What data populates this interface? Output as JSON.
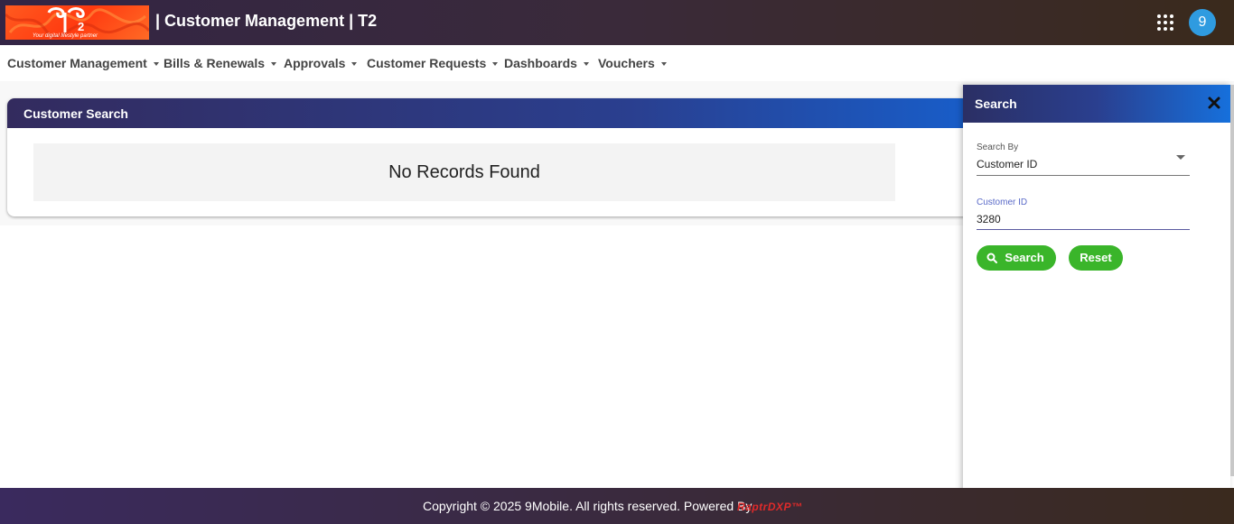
{
  "header": {
    "logo_text": "T2",
    "logo_tagline": "Your digital lifestyle partner",
    "title": "| Customer Management | T2",
    "avatar_initial": "9"
  },
  "nav": {
    "items": [
      {
        "label": "Customer Management"
      },
      {
        "label": "Bills & Renewals"
      },
      {
        "label": "Approvals"
      },
      {
        "label": "Customer Requests"
      },
      {
        "label": "Dashboards"
      },
      {
        "label": "Vouchers"
      }
    ]
  },
  "main": {
    "card_title": "Customer Search",
    "empty_message": "No Records Found"
  },
  "search_panel": {
    "title": "Search",
    "search_by_label": "Search By",
    "search_by_value": "Customer ID",
    "customer_id_label": "Customer ID",
    "customer_id_value": "3280",
    "search_button": "Search",
    "reset_button": "Reset"
  },
  "footer": {
    "copyright": "Copyright © 2025 9Mobile. All rights reserved. Powered By",
    "brand": "RaptrDXP™"
  },
  "colors": {
    "button_green": "#3ab52a",
    "avatar_blue": "#2f9be0",
    "logo_orange": "#ff5a1f"
  }
}
